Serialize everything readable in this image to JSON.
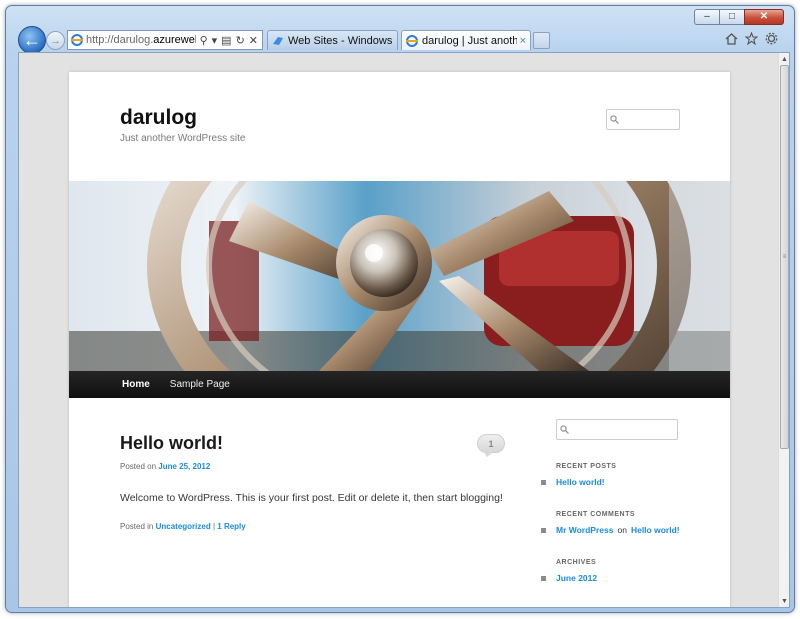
{
  "browser": {
    "address_bar": {
      "url_prefix": "http://darulog.",
      "url_domain": "azurewebsites",
      "url_suffix": "...."
    },
    "tabs": [
      {
        "label": "Web Sites - Windows Azure"
      },
      {
        "label": "darulog | Just another W..."
      }
    ],
    "tab_close_glyph": "×",
    "window_buttons": {
      "minimize": "–",
      "maximize": "□",
      "close": "✕"
    },
    "colors": {
      "accent": "#2a6fc4",
      "frame": "#b9d3ee"
    }
  },
  "site": {
    "title": "darulog",
    "description": "Just another WordPress site",
    "menu": [
      {
        "label": "Home"
      },
      {
        "label": "Sample Page"
      }
    ]
  },
  "post": {
    "title": "Hello world!",
    "comment_count": "1",
    "posted_on_label": "Posted on",
    "date": "June 25, 2012",
    "body": "Welcome to WordPress. This is your first post. Edit or delete it, then start blogging!",
    "posted_in_label": "Posted in",
    "category": "Uncategorized",
    "separator": "|",
    "reply_link": "1 Reply"
  },
  "sidebar": {
    "recent_posts_title": "RECENT POSTS",
    "recent_posts": [
      {
        "label": "Hello world!"
      }
    ],
    "recent_comments_title": "RECENT COMMENTS",
    "recent_comments": [
      {
        "author": "Mr WordPress",
        "on": "on",
        "post": "Hello world!"
      }
    ],
    "archives_title": "ARCHIVES",
    "archives": [
      {
        "label": "June 2012"
      }
    ]
  },
  "colors": {
    "link": "#1b8be0",
    "menubar": "#1a1a1a"
  }
}
